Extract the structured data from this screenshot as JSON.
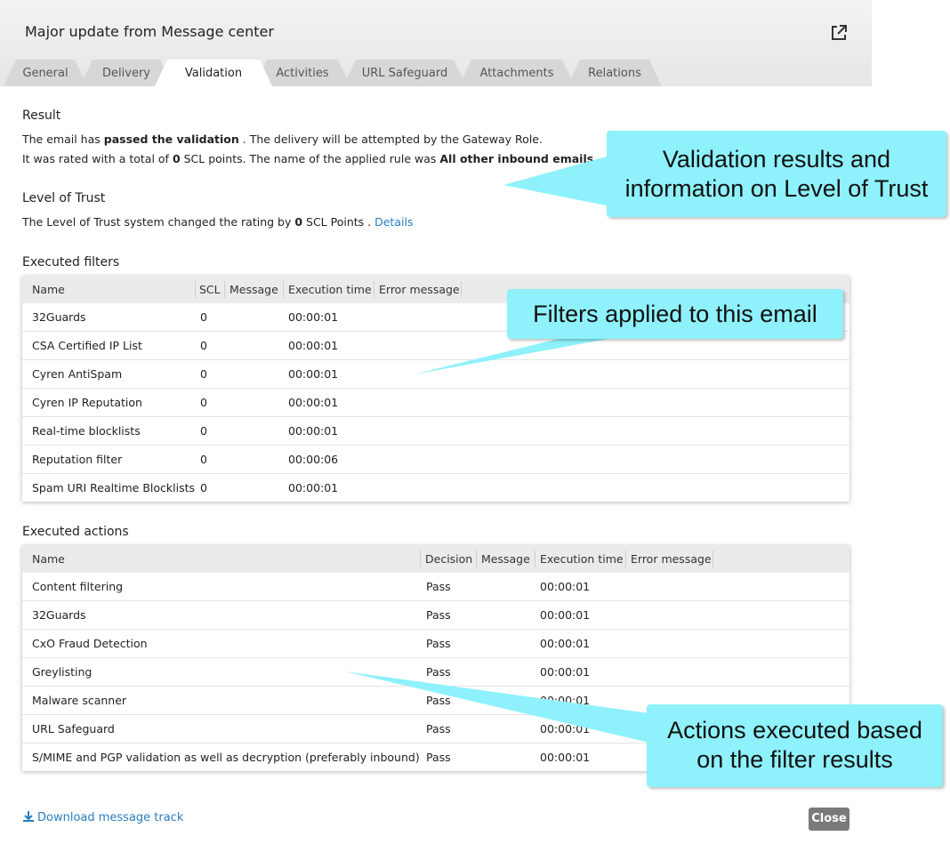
{
  "header": {
    "title": "Major update from Message center"
  },
  "tabs": [
    {
      "label": "General"
    },
    {
      "label": "Delivery"
    },
    {
      "label": "Validation"
    },
    {
      "label": "Activities"
    },
    {
      "label": "URL Safeguard"
    },
    {
      "label": "Attachments"
    },
    {
      "label": "Relations"
    }
  ],
  "result": {
    "title": "Result",
    "line1_a": "The email has ",
    "line1_b": "passed the validation",
    "line1_c": " . The delivery will be attempted by the Gateway Role.",
    "line2_a": "It was rated with a total of ",
    "line2_b": "0",
    "line2_c": " SCL points. The name of the applied rule was ",
    "line2_d": "All other inbound emails",
    "line2_e": " ."
  },
  "trust": {
    "title": "Level of Trust",
    "line_a": "The Level of Trust system changed the rating by ",
    "line_b": "0",
    "line_c": " SCL Points . ",
    "details_link": "Details"
  },
  "filters": {
    "title": "Executed filters",
    "columns": [
      "Name",
      "SCL",
      "Message",
      "Execution time",
      "Error message"
    ],
    "rows": [
      {
        "name": "32Guards",
        "scl": "0",
        "message": "",
        "time": "00:00:01",
        "error": ""
      },
      {
        "name": "CSA Certified IP List",
        "scl": "0",
        "message": "",
        "time": "00:00:01",
        "error": ""
      },
      {
        "name": "Cyren AntiSpam",
        "scl": "0",
        "message": "",
        "time": "00:00:01",
        "error": ""
      },
      {
        "name": "Cyren IP Reputation",
        "scl": "0",
        "message": "",
        "time": "00:00:01",
        "error": ""
      },
      {
        "name": "Real-time blocklists",
        "scl": "0",
        "message": "",
        "time": "00:00:01",
        "error": ""
      },
      {
        "name": "Reputation filter",
        "scl": "0",
        "message": "",
        "time": "00:00:06",
        "error": ""
      },
      {
        "name": "Spam URI Realtime Blocklists",
        "scl": "0",
        "message": "",
        "time": "00:00:01",
        "error": ""
      }
    ]
  },
  "actions": {
    "title": "Executed actions",
    "columns": [
      "Name",
      "Decision",
      "Message",
      "Execution time",
      "Error message"
    ],
    "rows": [
      {
        "name": "Content filtering",
        "decision": "Pass",
        "message": "",
        "time": "00:00:01",
        "error": ""
      },
      {
        "name": "32Guards",
        "decision": "Pass",
        "message": "",
        "time": "00:00:01",
        "error": ""
      },
      {
        "name": "CxO Fraud Detection",
        "decision": "Pass",
        "message": "",
        "time": "00:00:01",
        "error": ""
      },
      {
        "name": "Greylisting",
        "decision": "Pass",
        "message": "",
        "time": "00:00:01",
        "error": ""
      },
      {
        "name": "Malware scanner",
        "decision": "Pass",
        "message": "",
        "time": "00:00:01",
        "error": ""
      },
      {
        "name": "URL Safeguard",
        "decision": "Pass",
        "message": "",
        "time": "00:00:01",
        "error": ""
      },
      {
        "name": "S/MIME and PGP validation as well as decryption (preferably inbound)",
        "decision": "Pass",
        "message": "",
        "time": "00:00:01",
        "error": ""
      }
    ]
  },
  "callouts": {
    "validation_line1": "Validation results and",
    "validation_line2": "information on Level of Trust",
    "filters": "Filters applied to this email",
    "actions_line1": "Actions executed based",
    "actions_line2": "on the filter results",
    "color": "#8ef1fb"
  },
  "footer": {
    "download_label": "Download message track",
    "close_label": "Close"
  },
  "icons": [
    "external-link-icon",
    "download-icon"
  ]
}
